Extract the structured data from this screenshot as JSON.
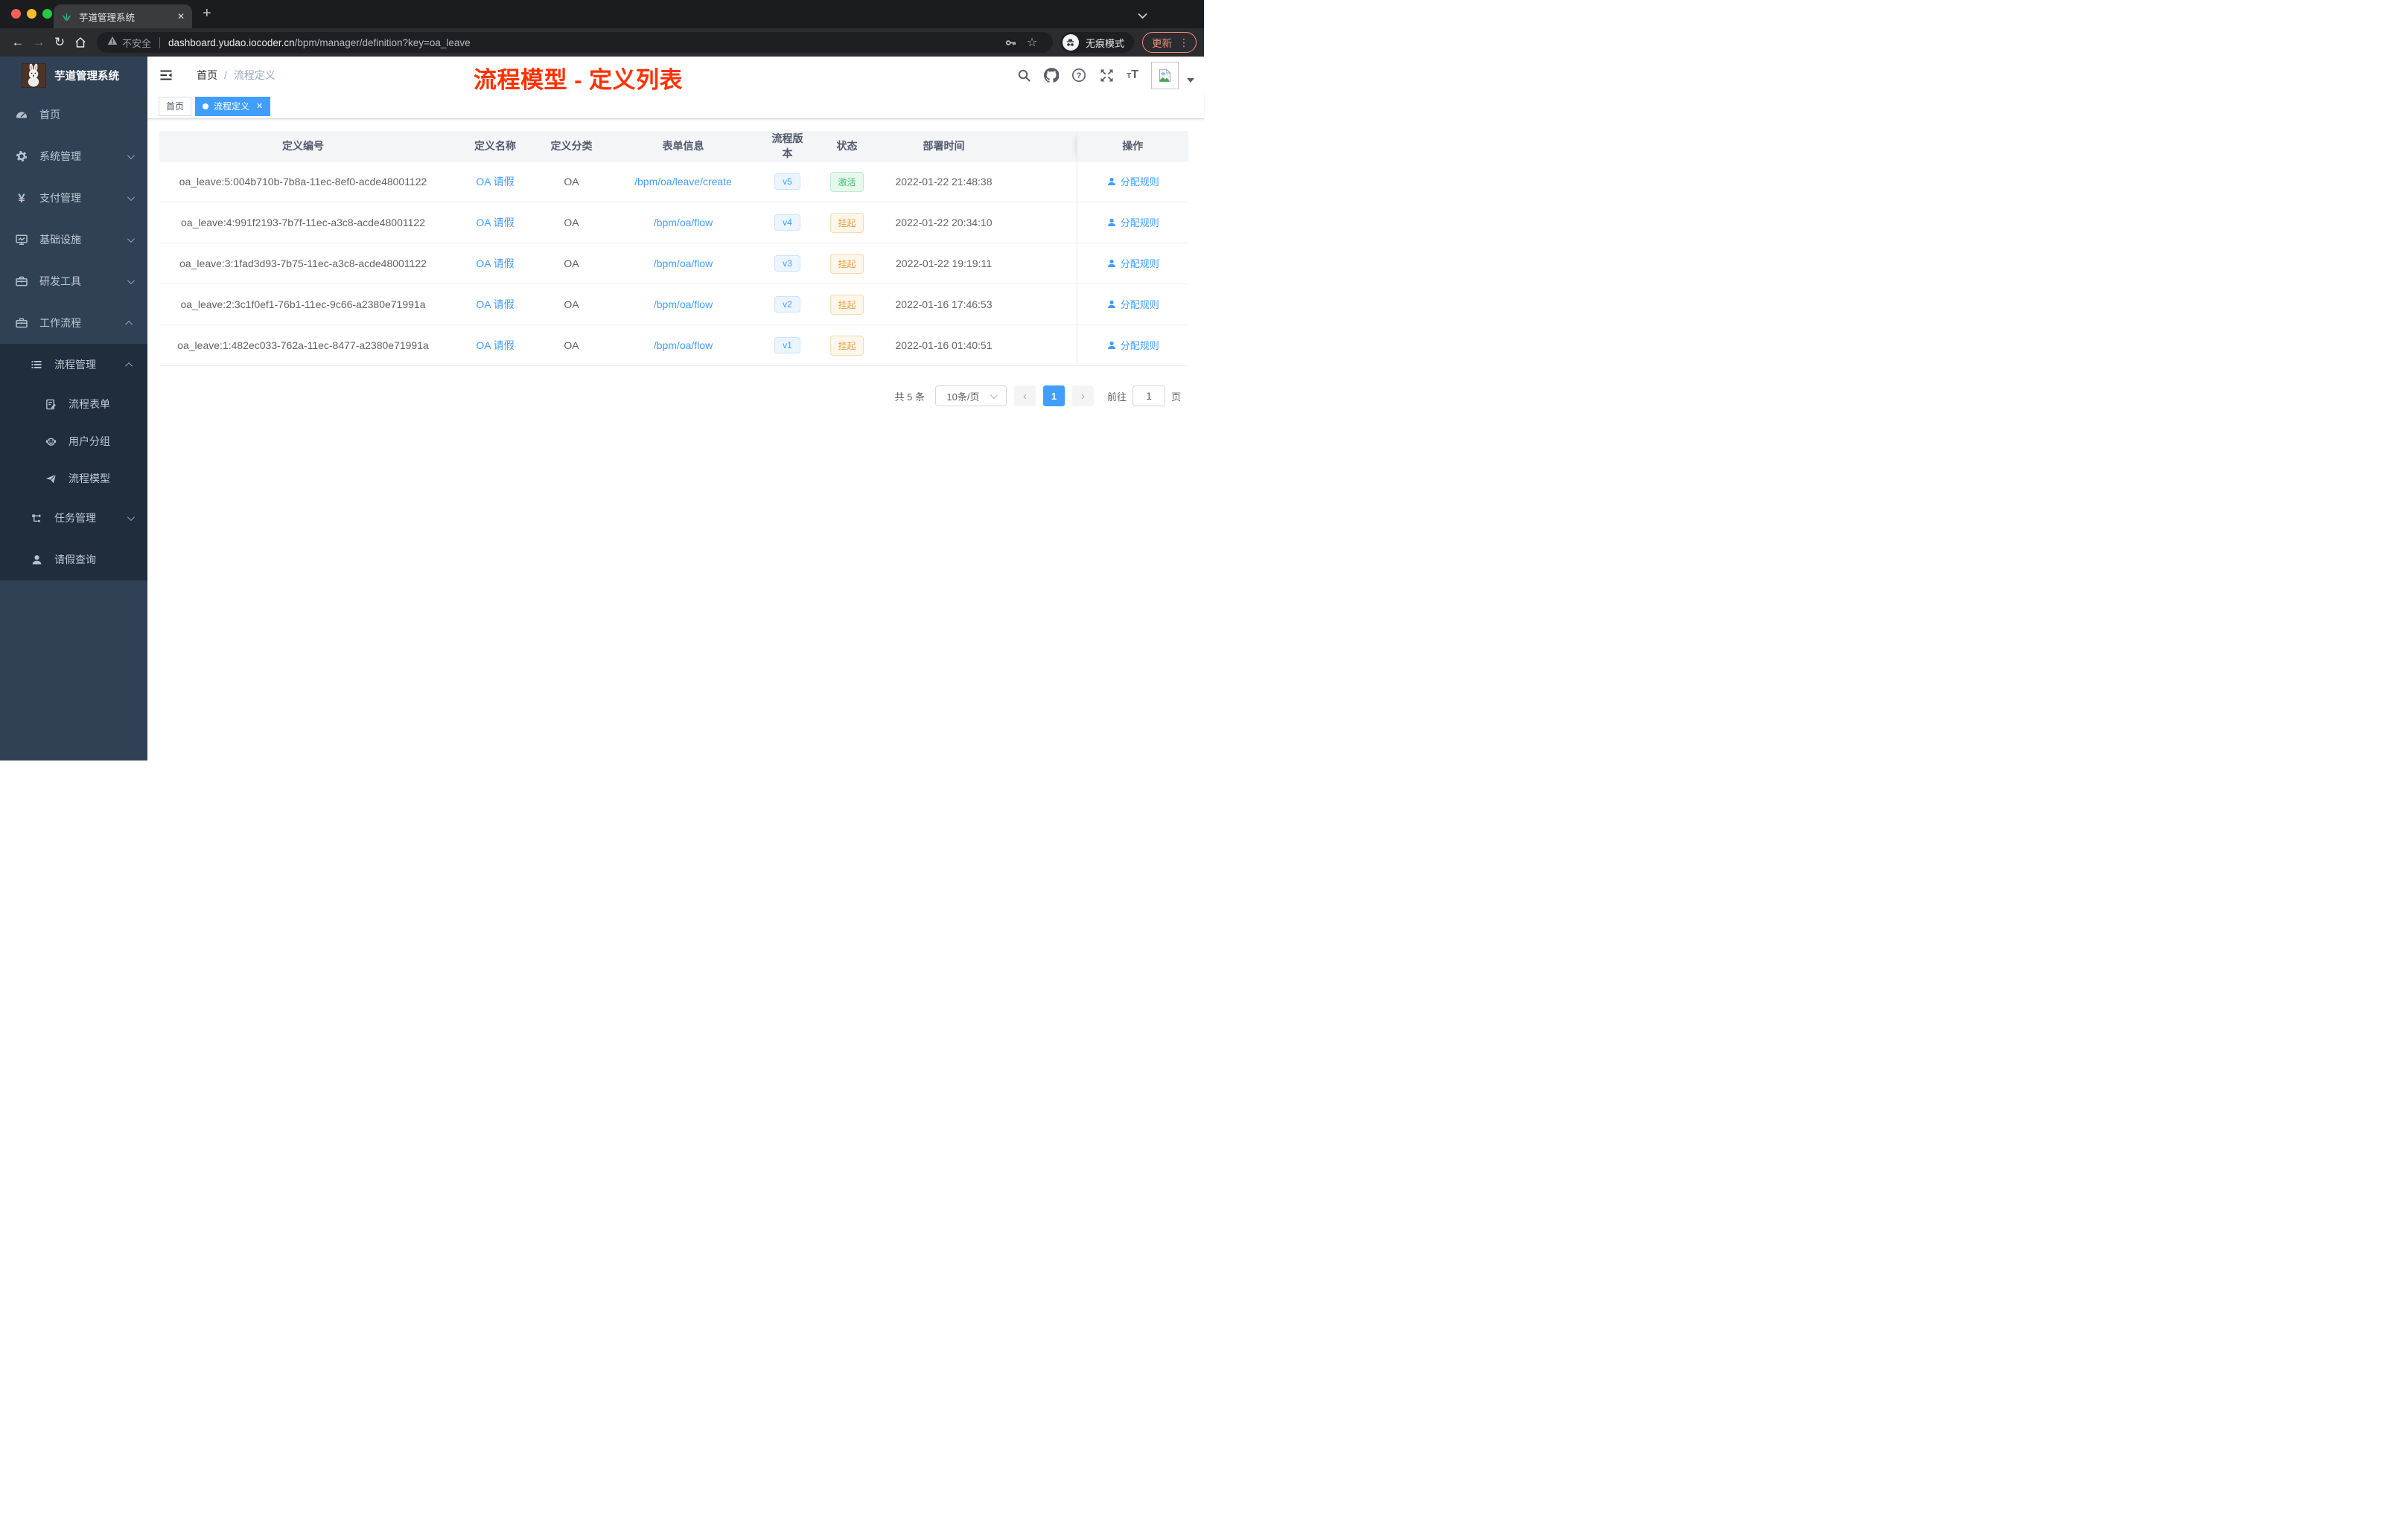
{
  "browser": {
    "tab_title": "芋道管理系统",
    "new_tab_glyph": "+",
    "close_glyph": "✕",
    "security_label": "不安全",
    "url_domain": "dashboard.yudao.iocoder.cn",
    "url_path": "/bpm/manager/definition?key=oa_leave",
    "incognito_label": "无痕模式",
    "update_label": "更新",
    "menu_dots_glyph": "⋮",
    "star_glyph": "☆",
    "back_glyph": "←",
    "forward_glyph": "→",
    "reload_glyph": "↻"
  },
  "sidebar": {
    "app_title": "芋道管理系统",
    "items_top": [
      "首页",
      "系统管理",
      "支付管理",
      "基础设施",
      "研发工具",
      "工作流程"
    ],
    "yen_glyph": "¥",
    "submenu": {
      "group_label": "流程管理",
      "children": [
        "流程表单",
        "用户分组",
        "流程模型"
      ],
      "siblings": [
        "任务管理",
        "请假查询"
      ]
    }
  },
  "header": {
    "breadcrumb_home": "首页",
    "breadcrumb_sep": "/",
    "breadcrumb_current": "流程定义",
    "overlay_title": "流程模型 - 定义列表",
    "question_glyph": "?"
  },
  "tags": {
    "home": "首页",
    "active": "流程定义",
    "active_close_glyph": "✕"
  },
  "table": {
    "columns": [
      "定义编号",
      "定义名称",
      "定义分类",
      "表单信息",
      "流程版本",
      "状态",
      "部署时间",
      "操作"
    ],
    "rows": [
      {
        "id": "oa_leave:5:004b710b-7b8a-11ec-8ef0-acde48001122",
        "name": "OA 请假",
        "category": "OA",
        "form": "/bpm/oa/leave/create",
        "version": "v5",
        "status": "激活",
        "time": "2022-01-22 21:48:38",
        "op": "分配规则"
      },
      {
        "id": "oa_leave:4:991f2193-7b7f-11ec-a3c8-acde48001122",
        "name": "OA 请假",
        "category": "OA",
        "form": "/bpm/oa/flow",
        "version": "v4",
        "status": "挂起",
        "time": "2022-01-22 20:34:10",
        "op": "分配规则"
      },
      {
        "id": "oa_leave:3:1fad3d93-7b75-11ec-a3c8-acde48001122",
        "name": "OA 请假",
        "category": "OA",
        "form": "/bpm/oa/flow",
        "version": "v3",
        "status": "挂起",
        "time": "2022-01-22 19:19:11",
        "op": "分配规则"
      },
      {
        "id": "oa_leave:2:3c1f0ef1-76b1-11ec-9c66-a2380e71991a",
        "name": "OA 请假",
        "category": "OA",
        "form": "/bpm/oa/flow",
        "version": "v2",
        "status": "挂起",
        "time": "2022-01-16 17:46:53",
        "op": "分配规则"
      },
      {
        "id": "oa_leave:1:482ec033-762a-11ec-8477-a2380e71991a",
        "name": "OA 请假",
        "category": "OA",
        "form": "/bpm/oa/flow",
        "version": "v1",
        "status": "挂起",
        "time": "2022-01-16 01:40:51",
        "op": "分配规则"
      }
    ]
  },
  "pagination": {
    "total_label": "共 5 条",
    "page_size_label": "10条/页",
    "prev_glyph": "‹",
    "next_glyph": "›",
    "current_page": "1",
    "goto_label": "前往",
    "goto_value": "1",
    "page_unit": "页"
  },
  "colors": {
    "accent_blue": "#409eff",
    "status_active_green": "#41c06e",
    "status_suspended_yellow": "#e6a23c",
    "overlay_title_red": "#ff3100",
    "sidebar_bg": "#304156",
    "submenu_bg": "#1f2d3d"
  }
}
